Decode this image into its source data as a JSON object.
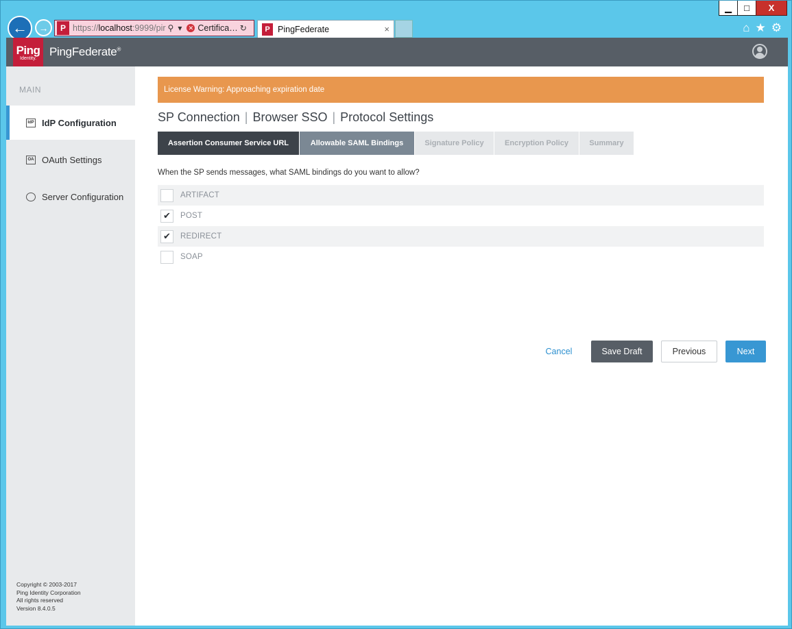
{
  "window": {
    "minimize_label": "▁",
    "maximize_label": "□",
    "close_label": "X"
  },
  "browser": {
    "address": {
      "scheme": "https://",
      "host": "localhost",
      "rest": ":9999/pir"
    },
    "cert_label": "Certifica…",
    "tab_title": "PingFederate",
    "tab_close": "×"
  },
  "app": {
    "logo_main": "Ping",
    "logo_sub": "Identity.",
    "brand": "PingFederate",
    "brand_mark": "®"
  },
  "sidebar": {
    "heading": "MAIN",
    "items": [
      {
        "label": "IdP Configuration",
        "icon_text": "IdP"
      },
      {
        "label": "OAuth Settings",
        "icon_text": "OA"
      },
      {
        "label": "Server Configuration",
        "icon_text": ""
      }
    ],
    "copyright_lines": [
      "Copyright © 2003-2017",
      "Ping Identity Corporation",
      "All rights reserved",
      "Version 8.4.0.5"
    ]
  },
  "main": {
    "warning": "License Warning: Approaching expiration date",
    "breadcrumb": [
      "SP Connection",
      "Browser SSO",
      "Protocol Settings"
    ],
    "steps": [
      {
        "label": "Assertion Consumer Service URL",
        "state": "done"
      },
      {
        "label": "Allowable SAML Bindings",
        "state": "current"
      },
      {
        "label": "Signature Policy",
        "state": "todo"
      },
      {
        "label": "Encryption Policy",
        "state": "todo"
      },
      {
        "label": "Summary",
        "state": "todo"
      }
    ],
    "question": "When the SP sends messages, what SAML bindings do you want to allow?",
    "bindings": [
      {
        "label": "ARTIFACT",
        "checked": false
      },
      {
        "label": "POST",
        "checked": true
      },
      {
        "label": "REDIRECT",
        "checked": true
      },
      {
        "label": "SOAP",
        "checked": false
      }
    ],
    "buttons": {
      "cancel": "Cancel",
      "save_draft": "Save Draft",
      "previous": "Previous",
      "next": "Next"
    }
  },
  "colors": {
    "accent": "#3897d3",
    "warning": "#e8974e",
    "topbar": "#575e66",
    "brand_red": "#c41e3a"
  }
}
